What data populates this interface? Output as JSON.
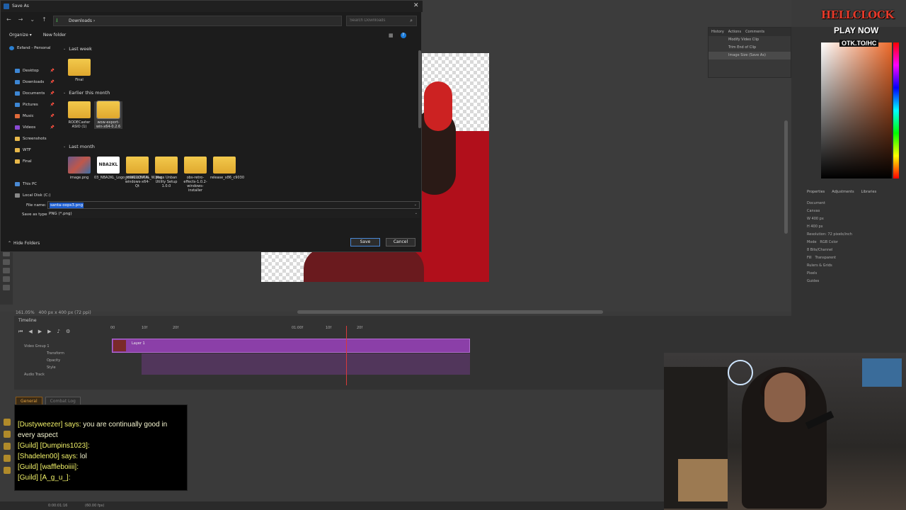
{
  "dialog": {
    "title": "Save As",
    "close_glyph": "✕",
    "address_path": "Downloads",
    "address_chevron": "›",
    "search_placeholder": "Search Downloads",
    "toolbar": {
      "organize": "Organize ▾",
      "new_folder": "New folder"
    },
    "sidebar": [
      {
        "label": "Esfand - Personal",
        "icon": "cloud-icon"
      },
      {
        "label": "Desktop",
        "icon": "desktop-icon",
        "pinned": true
      },
      {
        "label": "Downloads",
        "icon": "downloads-icon",
        "pinned": true
      },
      {
        "label": "Documents",
        "icon": "documents-icon",
        "pinned": true
      },
      {
        "label": "Pictures",
        "icon": "pictures-icon",
        "pinned": true
      },
      {
        "label": "Music",
        "icon": "music-icon",
        "pinned": true
      },
      {
        "label": "Videos",
        "icon": "videos-icon",
        "pinned": true
      },
      {
        "label": "Screenshots",
        "icon": "folder-icon"
      },
      {
        "label": "WTF",
        "icon": "folder-icon"
      },
      {
        "label": "Final",
        "icon": "folder-icon"
      },
      {
        "label": "This PC",
        "icon": "pc-icon"
      },
      {
        "label": "Local Disk (C:)",
        "icon": "disk-icon"
      }
    ],
    "groups": {
      "last_week": "Last week",
      "earlier_this_month": "Earlier this month",
      "last_month": "Last month"
    },
    "files_last_week": [
      {
        "name": "Final",
        "kind": "folder"
      }
    ],
    "files_earlier": [
      {
        "name": "RODECaster ASIO (1)",
        "kind": "folder"
      },
      {
        "name": "wow-export-win-x64-0.2.6",
        "kind": "folder"
      }
    ],
    "files_last_month": [
      {
        "name": "image.png",
        "kind": "image"
      },
      {
        "name": "03_NBA2KL_Logo_HORIZONTAL_W.png",
        "kind": "text",
        "thumb_text": "NBA2KL"
      },
      {
        "name": "pcsx2-v2.4.0-windows-x64-Qt",
        "kind": "folder"
      },
      {
        "name": "Mass Unban Utility Setup 1.0.0",
        "kind": "folder"
      },
      {
        "name": "obs-retro-effects-1.0.2-windows-installer",
        "kind": "folder"
      },
      {
        "name": "release_x86_c9030",
        "kind": "folder"
      }
    ],
    "file_name_label": "File name:",
    "file_name_value": "santa-oops3.png",
    "save_as_type_label": "Save as type:",
    "save_as_type_value": "PNG (*.png)",
    "hide_folders": "Hide Folders",
    "save_button": "Save",
    "cancel_button": "Cancel"
  },
  "photoshop": {
    "status": "161.05%",
    "doc_info": "400 px x 400 px (72 ppi)",
    "history_tabs": [
      "History",
      "Actions",
      "Comments"
    ],
    "history_items": [
      "Modify Video Clip",
      "Trim End of Clip",
      "Image Size (Save As)"
    ],
    "properties_tabs": [
      "Properties",
      "Adjustments",
      "Libraries"
    ],
    "properties": {
      "document": "Document",
      "canvas": "Canvas",
      "w": "400 px",
      "h": "400 px",
      "resolution": "Resolution: 72 pixels/inch",
      "mode_label": "Mode",
      "mode_value": "RGB Color",
      "bit_depth": "8 Bits/Channel",
      "fill_label": "Fill",
      "fill_value": "Transparent",
      "rulers_grids": "Rulers & Grids",
      "units": "Pixels",
      "guides": "Guides"
    },
    "timeline": {
      "title": "Timeline",
      "ruler": [
        "00",
        "10f",
        "20f",
        "01:00f",
        "10f",
        "20f",
        "02:00f",
        "10f",
        "20f",
        "30f",
        "40f",
        "50f"
      ],
      "layer": "Layer 1",
      "video_group": "Video Group 1",
      "props": [
        "Transform",
        "Opacity",
        "Style"
      ],
      "audio_track": "Audio Track"
    },
    "bottom_bar": {
      "time": "0:00:01:16",
      "fps": "(60.00 fps)"
    }
  },
  "chat": {
    "tabs": [
      "General",
      "Combat Log"
    ],
    "lines": [
      {
        "who": "[Guild] [waffleboiiii]:",
        "text": ""
      },
      {
        "who": "[Dustyweezer] says:",
        "text": "you are continually good in every aspect"
      },
      {
        "who": "[Guild] [Dumpins1023]:",
        "text": ""
      },
      {
        "who": "[Shadelen00] says:",
        "text": "lol"
      },
      {
        "who": "[Guild] [waffleboiiii]:",
        "text": ""
      },
      {
        "who": "[Guild] [A_g_u_]:",
        "text": ""
      }
    ]
  },
  "logo": {
    "name": "HELLCLOCK",
    "play": "PLAY NOW",
    "url": "OTK.TO/HC"
  }
}
